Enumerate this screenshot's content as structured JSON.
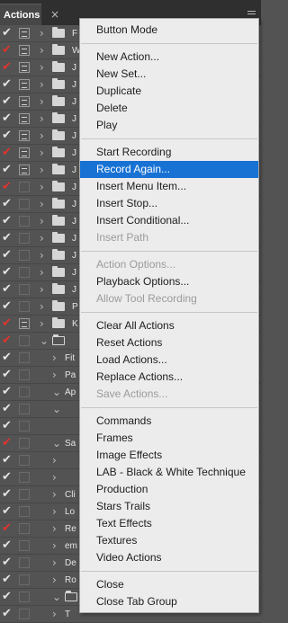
{
  "panel": {
    "tab_label": "Actions",
    "close_glyph": "×"
  },
  "icons": {
    "check": "✔",
    "chevron_right": "›",
    "chevron_down": "⌄",
    "row_toggle": "dialog-toggle-icon",
    "folder": "folder-icon",
    "panel_menu": "panel-menu-icon"
  },
  "colors": {
    "panel_bg": "#535353",
    "menu_bg": "#ececec",
    "highlight": "#1872d4",
    "check_red": "#e3332d",
    "disabled_text": "#9b9b9b"
  },
  "rows": [
    {
      "check_red": false,
      "toggle": "on",
      "chevron": "right",
      "icon": "folder",
      "label": "F"
    },
    {
      "check_red": true,
      "toggle": "on",
      "chevron": "right",
      "icon": "folder",
      "label": "W"
    },
    {
      "check_red": true,
      "toggle": "on",
      "chevron": "right",
      "icon": "folder",
      "label": "J"
    },
    {
      "check_red": false,
      "toggle": "on",
      "chevron": "right",
      "icon": "folder",
      "label": "J"
    },
    {
      "check_red": false,
      "toggle": "on",
      "chevron": "right",
      "icon": "folder",
      "label": "J"
    },
    {
      "check_red": false,
      "toggle": "on",
      "chevron": "right",
      "icon": "folder",
      "label": "J"
    },
    {
      "check_red": false,
      "toggle": "on",
      "chevron": "right",
      "icon": "folder",
      "label": "J"
    },
    {
      "check_red": true,
      "toggle": "on",
      "chevron": "right",
      "icon": "folder",
      "label": "J"
    },
    {
      "check_red": false,
      "toggle": "on",
      "chevron": "right",
      "icon": "folder",
      "label": "J"
    },
    {
      "check_red": true,
      "toggle": "off",
      "chevron": "right",
      "icon": "folder",
      "label": "J"
    },
    {
      "check_red": false,
      "toggle": "off",
      "chevron": "right",
      "icon": "folder",
      "label": "J"
    },
    {
      "check_red": false,
      "toggle": "off",
      "chevron": "right",
      "icon": "folder",
      "label": "J"
    },
    {
      "check_red": false,
      "toggle": "off",
      "chevron": "right",
      "icon": "folder",
      "label": "J"
    },
    {
      "check_red": false,
      "toggle": "off",
      "chevron": "right",
      "icon": "folder",
      "label": "J"
    },
    {
      "check_red": false,
      "toggle": "off",
      "chevron": "right",
      "icon": "folder",
      "label": "J"
    },
    {
      "check_red": false,
      "toggle": "off",
      "chevron": "right",
      "icon": "folder",
      "label": "J"
    },
    {
      "check_red": false,
      "toggle": "off",
      "chevron": "right",
      "icon": "folder",
      "label": "P"
    },
    {
      "check_red": true,
      "toggle": "on",
      "chevron": "right",
      "icon": "folder",
      "label": "K"
    },
    {
      "check_red": true,
      "toggle": "off",
      "chevron": "down",
      "icon": "folder-open",
      "label": ""
    },
    {
      "check_red": false,
      "toggle": "off",
      "chevron": "right",
      "icon": "",
      "label": "Fit"
    },
    {
      "check_red": false,
      "toggle": "off",
      "chevron": "right",
      "icon": "",
      "label": "Pa"
    },
    {
      "check_red": false,
      "toggle": "off",
      "chevron": "down",
      "icon": "",
      "label": "Ap"
    },
    {
      "check_red": false,
      "toggle": "off",
      "chevron": "down",
      "icon": "",
      "label": ""
    },
    {
      "check_red": false,
      "toggle": "off",
      "chevron": "",
      "icon": "",
      "label": ""
    },
    {
      "check_red": true,
      "toggle": "off",
      "chevron": "down",
      "icon": "",
      "label": "Sa"
    },
    {
      "check_red": false,
      "toggle": "off",
      "chevron": "right",
      "icon": "",
      "label": ""
    },
    {
      "check_red": false,
      "toggle": "off",
      "chevron": "right",
      "icon": "",
      "label": ""
    },
    {
      "check_red": false,
      "toggle": "off",
      "chevron": "right",
      "icon": "",
      "label": "Cli"
    },
    {
      "check_red": false,
      "toggle": "off",
      "chevron": "right",
      "icon": "",
      "label": "Lo"
    },
    {
      "check_red": true,
      "toggle": "off",
      "chevron": "right",
      "icon": "",
      "label": "Re"
    },
    {
      "check_red": false,
      "toggle": "off",
      "chevron": "right",
      "icon": "",
      "label": "em"
    },
    {
      "check_red": false,
      "toggle": "off",
      "chevron": "right",
      "icon": "",
      "label": "De"
    },
    {
      "check_red": false,
      "toggle": "off",
      "chevron": "right",
      "icon": "",
      "label": "Ro"
    },
    {
      "check_red": false,
      "toggle": "off",
      "chevron": "down",
      "icon": "folder-open",
      "label": "T"
    },
    {
      "check_red": false,
      "toggle": "off",
      "chevron": "right",
      "icon": "",
      "label": "T"
    }
  ],
  "menu": {
    "groups": [
      [
        {
          "label": "Button Mode",
          "disabled": false
        }
      ],
      [
        {
          "label": "New Action...",
          "disabled": false
        },
        {
          "label": "New Set...",
          "disabled": false
        },
        {
          "label": "Duplicate",
          "disabled": false
        },
        {
          "label": "Delete",
          "disabled": false
        },
        {
          "label": "Play",
          "disabled": false
        }
      ],
      [
        {
          "label": "Start Recording",
          "disabled": false
        },
        {
          "label": "Record Again...",
          "disabled": false,
          "highlighted": true
        },
        {
          "label": "Insert Menu Item...",
          "disabled": false
        },
        {
          "label": "Insert Stop...",
          "disabled": false
        },
        {
          "label": "Insert Conditional...",
          "disabled": false
        },
        {
          "label": "Insert Path",
          "disabled": true
        }
      ],
      [
        {
          "label": "Action Options...",
          "disabled": true
        },
        {
          "label": "Playback Options...",
          "disabled": false
        },
        {
          "label": "Allow Tool Recording",
          "disabled": true
        }
      ],
      [
        {
          "label": "Clear All Actions",
          "disabled": false
        },
        {
          "label": "Reset Actions",
          "disabled": false
        },
        {
          "label": "Load Actions...",
          "disabled": false
        },
        {
          "label": "Replace Actions...",
          "disabled": false
        },
        {
          "label": "Save Actions...",
          "disabled": true
        }
      ],
      [
        {
          "label": "Commands",
          "disabled": false
        },
        {
          "label": "Frames",
          "disabled": false
        },
        {
          "label": "Image Effects",
          "disabled": false
        },
        {
          "label": "LAB - Black & White Technique",
          "disabled": false
        },
        {
          "label": "Production",
          "disabled": false
        },
        {
          "label": "Stars Trails",
          "disabled": false
        },
        {
          "label": "Text Effects",
          "disabled": false
        },
        {
          "label": "Textures",
          "disabled": false
        },
        {
          "label": "Video Actions",
          "disabled": false
        }
      ],
      [
        {
          "label": "Close",
          "disabled": false
        },
        {
          "label": "Close Tab Group",
          "disabled": false
        }
      ]
    ]
  }
}
